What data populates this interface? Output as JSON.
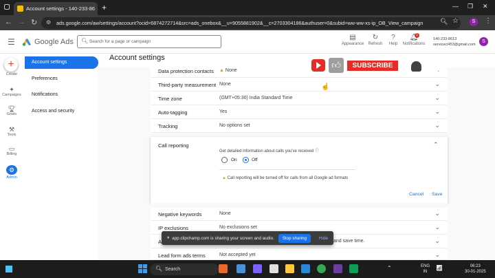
{
  "browser": {
    "tab_title": "Account settings - 140-233-86",
    "url": "ads.google.com/aw/settings/account?ocid=6874272714&src=ads_onebox&__u=9055881902&__c=2703304186&authuser=0&subid=ww-ww-xs-ip_OB_View_campaign"
  },
  "header": {
    "app_name": "Google Ads",
    "search_placeholder": "Search for a page or campaign",
    "icons": [
      {
        "label": "Appearance",
        "icon": "appearance-icon"
      },
      {
        "label": "Refresh",
        "icon": "refresh-icon"
      },
      {
        "label": "Help",
        "icon": "help-icon"
      },
      {
        "label": "Notifications",
        "icon": "bell-icon",
        "badge": "1"
      }
    ],
    "account_id": "140-233-8613",
    "account_email": "servicect453@gmail.com",
    "avatar_letter": "S"
  },
  "rail": [
    {
      "label": "Create",
      "icon": "plus-icon"
    },
    {
      "label": "Campaigns",
      "icon": "campaigns-icon"
    },
    {
      "label": "Goals",
      "icon": "goals-icon"
    },
    {
      "label": "Tools",
      "icon": "tools-icon"
    },
    {
      "label": "Billing",
      "icon": "billing-icon"
    },
    {
      "label": "Admin",
      "icon": "admin-icon",
      "active": true
    }
  ],
  "sidenav": [
    "Account settings",
    "Preferences",
    "Notifications",
    "Access and security"
  ],
  "page_title": "Account settings",
  "settings_top": [
    {
      "label": "Data protection contacts",
      "value": "None",
      "warning": true
    },
    {
      "label": "Third-party measurement",
      "value": "None"
    },
    {
      "label": "Time zone",
      "value": "(GMT+05:30) India Standard Time"
    },
    {
      "label": "Auto-tagging",
      "value": "Yes"
    },
    {
      "label": "Tracking",
      "value": "No options set"
    }
  ],
  "call_reporting": {
    "label": "Call reporting",
    "description": "Get detailed information about calls you've received",
    "option_on": "On",
    "option_off": "Off",
    "selected": "Off",
    "warning": "Call reporting will be turned off for calls from all Google ad formats",
    "cancel": "Cancel",
    "save": "Save"
  },
  "settings_bottom": [
    {
      "label": "Negative keywords",
      "value": "None"
    },
    {
      "label": "IP exclusions",
      "value": "No exclusions set"
    },
    {
      "label": "Ac",
      "value": "and save time."
    },
    {
      "label": "Lead form ads terms",
      "value": "Not accepted yet"
    }
  ],
  "overlay": {
    "subscribe": "SUBSCRIBE"
  },
  "share_bar": {
    "text": "app.clipchamp.com is sharing your screen and audio.",
    "stop": "Stop sharing",
    "hide": "Hide"
  },
  "taskbar": {
    "search": "Search",
    "lang": "ENG",
    "region": "IN",
    "time": "06:23",
    "date": "30-01-2025"
  },
  "colors": {
    "accent": "#1a73e8",
    "warning": "#f29900",
    "youtube_red": "#e52d27"
  }
}
